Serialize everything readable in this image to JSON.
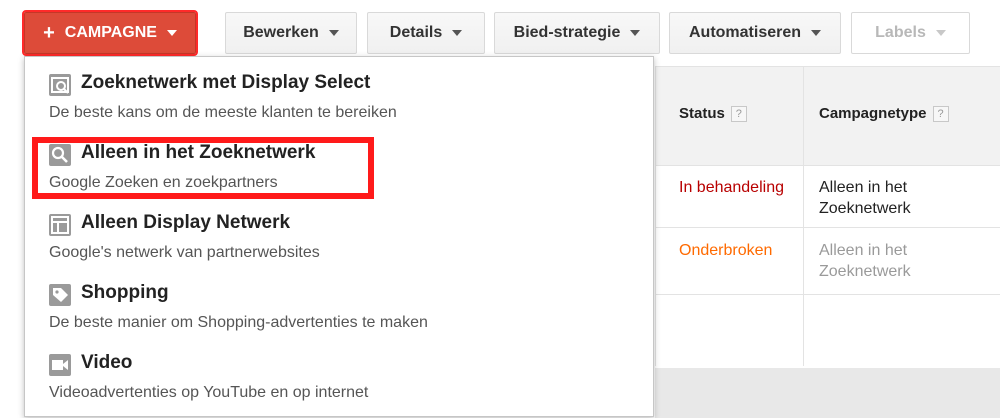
{
  "toolbar": {
    "campaign_label": "CAMPAGNE",
    "edit_label": "Bewerken",
    "details_label": "Details",
    "bid_strategy_label": "Bied-strategie",
    "automate_label": "Automatiseren",
    "labels_label": "Labels"
  },
  "table": {
    "headers": {
      "status": "Status",
      "campaign_type": "Campagnetype",
      "help": "?"
    },
    "rows": [
      {
        "status": "In behandeling",
        "campaign_type": "Alleen in het Zoeknetwerk"
      },
      {
        "status": "Onderbroken",
        "campaign_type": "Alleen in het Zoeknetwerk"
      }
    ]
  },
  "menu": {
    "items": [
      {
        "title": "Zoeknetwerk met Display Select",
        "description": "De beste kans om de meeste klanten te bereiken",
        "icon": "search-display-icon"
      },
      {
        "title": "Alleen in het Zoeknetwerk",
        "description": "Google Zoeken en zoekpartners",
        "icon": "search-icon"
      },
      {
        "title": "Alleen Display Netwerk",
        "description": "Google's netwerk van partnerwebsites",
        "icon": "display-network-icon"
      },
      {
        "title": "Shopping",
        "description": "De beste manier om Shopping-advertenties te maken",
        "icon": "tag-icon"
      },
      {
        "title": "Video",
        "description": "Videoadvertenties op YouTube en op internet",
        "icon": "video-icon"
      }
    ]
  },
  "colors": {
    "primary_button": "#dd4b39",
    "highlight": "#ff1a1a",
    "status_pending": "#b80000",
    "status_paused": "#ff6a00"
  }
}
